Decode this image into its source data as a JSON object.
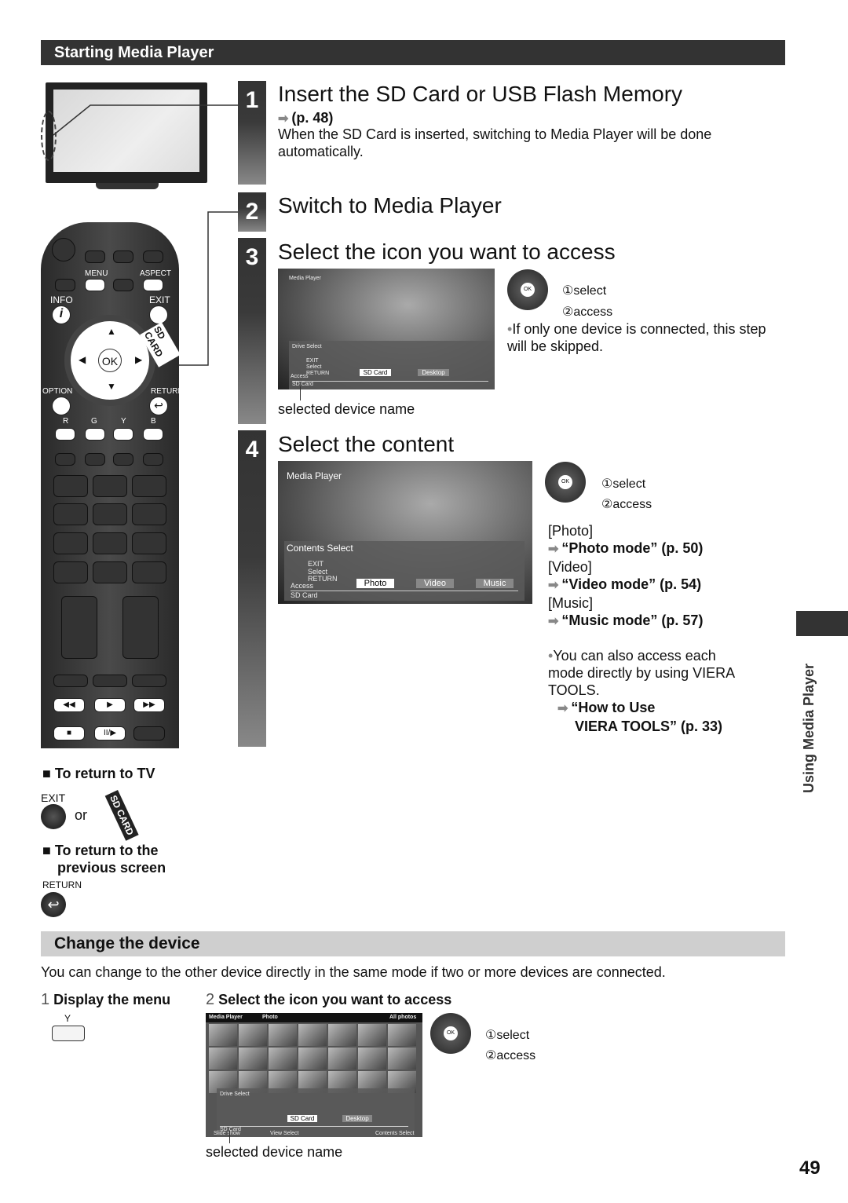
{
  "section": {
    "title": "Starting Media Player"
  },
  "steps": [
    {
      "num": "1",
      "title": "Insert the SD Card or USB Flash Memory",
      "ref": "(p. 48)",
      "text": "When the SD Card is inserted, switching to Media Player will be done automatically."
    },
    {
      "num": "2",
      "title": "Switch to Media Player"
    },
    {
      "num": "3",
      "title": "Select the icon you want to access",
      "screen": {
        "title": "Media Player",
        "panel_title": "Drive Select",
        "legend": [
          "EXIT",
          "Select",
          "RETURN",
          "Access"
        ],
        "devices": [
          "SD Card",
          "Desktop"
        ],
        "selected_device": "SD Card"
      },
      "caption": "selected device name",
      "nav": {
        "select": "①select",
        "access": "②access"
      },
      "note": "If only one device is connected, this step will be skipped."
    },
    {
      "num": "4",
      "title": "Select the content",
      "screen": {
        "title": "Media Player",
        "panel_title": "Contents Select",
        "legend": [
          "EXIT",
          "Select",
          "RETURN",
          "Access"
        ],
        "contents": [
          "Photo",
          "Video",
          "Music"
        ],
        "device": "SD Card"
      },
      "nav": {
        "select": "①select",
        "access": "②access"
      },
      "modes": [
        {
          "label": "[Photo]",
          "ref": "“Photo mode” (p. 50)"
        },
        {
          "label": "[Video]",
          "ref": "“Video mode” (p. 54)"
        },
        {
          "label": "[Music]",
          "ref": "“Music mode” (p. 57)"
        }
      ],
      "note": "You can also access each mode directly by using VIERA TOOLS.",
      "note_ref_1": "“How to Use",
      "note_ref_2": "VIERA TOOLS” (p. 33)"
    }
  ],
  "remote": {
    "labels": {
      "menu": "MENU",
      "aspect": "ASPECT",
      "info": "INFO",
      "exit": "EXIT",
      "option": "OPTION",
      "return": "RETURN",
      "ok": "OK",
      "sd_card": "SD CARD",
      "r": "R",
      "g": "G",
      "y": "Y",
      "b": "B"
    }
  },
  "return_tv": {
    "title": "To return to TV",
    "exit": "EXIT",
    "or": "or",
    "sd_card": "SD CARD"
  },
  "return_prev": {
    "title_1": "To return to the",
    "title_2": "previous screen",
    "return": "RETURN"
  },
  "change": {
    "title": "Change the device",
    "text": "You can change to the other device directly in the same mode if two or more devices are connected.",
    "step1": {
      "num": "1",
      "label": "Display the menu",
      "key": "Y"
    },
    "step2": {
      "num": "2",
      "label": "Select the icon you want to access",
      "screen": {
        "header_left": "Media Player",
        "header_mid": "Photo",
        "header_right": "All photos",
        "panel_title": "Drive Select",
        "devices": [
          "SD Card",
          "Desktop"
        ],
        "device": "SD Card",
        "footer": [
          "Slide show",
          "View Select",
          "",
          "Contents Select"
        ],
        "peek": "ard"
      },
      "caption": "selected device name",
      "nav": {
        "select": "①select",
        "access": "②access"
      }
    }
  },
  "side_tab": "Using Media Player",
  "page_number": "49"
}
